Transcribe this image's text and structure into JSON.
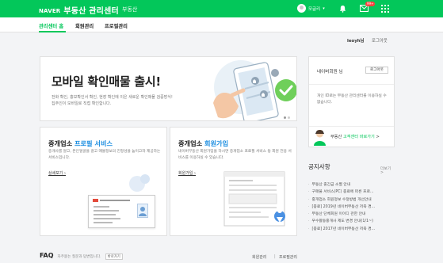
{
  "header": {
    "logo": "NAVER",
    "title": "부동산 관리센터",
    "subtitle": "부동산",
    "user_name": "모글리",
    "mail_badge": "99+",
    "colors": {
      "brand": "#03c75a"
    }
  },
  "nav": {
    "tabs": [
      {
        "label": "관리센터 홈",
        "active": true
      },
      {
        "label": "회원관리",
        "active": false
      },
      {
        "label": "프로필관리",
        "active": false
      }
    ]
  },
  "account": {
    "user_id": "leoyh님",
    "logout": "로그아웃"
  },
  "hero": {
    "title": "모바일 확인매물 출시!",
    "desc_line1": "전화 확인, 홍보확인서 확인, 현장 확인에 이은 새로운 확인매물 검증방식!",
    "desc_line2": "집주인이 모바일로 직접 확인합니다."
  },
  "services": [
    {
      "title_prefix": "중개업소 ",
      "title_highlight": "프로필 서비스",
      "desc": "중개사를 알고, 본인얼굴을 걸고 매물정보의 진정성을 높이고자 제공하는 서비스입니다.",
      "link": "상세보기"
    },
    {
      "title_prefix": "중개업소 ",
      "title_highlight": "회원가입",
      "desc": "네이버부동산 회원가입을 하시면 중개업소 프로필 서비스 등 회원 전용 서비스를 이용하실 수 있습니다.",
      "link": "회원가입"
    }
  ],
  "right_panel": {
    "member_title": "네이버회원 님",
    "login_button": "로그아웃",
    "desc": "개인 ID로는 부동산 관리센터를 이용하실 수 없습니다.",
    "cs_prefix": "부동산 ",
    "cs_highlight": "고객센터 바로가기",
    "cs_suffix": " >"
  },
  "notice": {
    "title": "공지사항",
    "more": "더보기 >",
    "items": [
      "부동산 출간금 소멸 안내",
      "구매불 서비스(PC) 종료에 따른 프로...",
      "중개업소 회원정보 수정방법 개선안내",
      "[종료] 2019년 네이버부동산 저축 경...",
      "부동산 단체회원 이이디 관한 안내",
      "우수활동중개사 제도 변경 안내(1/1~)",
      "[종료] 2017년 네이버부동산 저축 경..."
    ]
  },
  "faq": {
    "title": "FAQ",
    "desc": "자주묻는 질문과 답변입니다.",
    "button": "바로가기",
    "link1": "회원관리",
    "link2": "프로필관리"
  }
}
